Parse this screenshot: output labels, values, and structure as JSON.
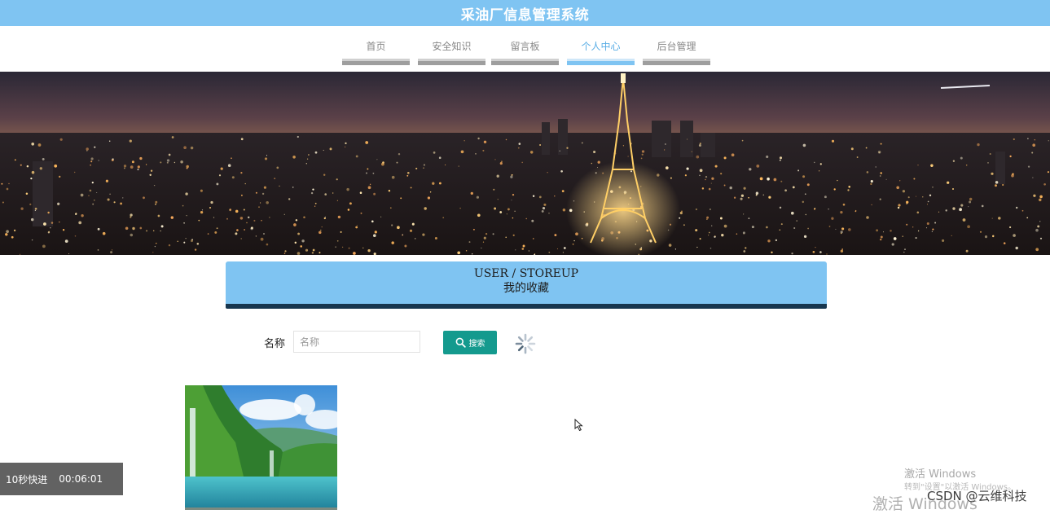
{
  "header": {
    "title": "采油厂信息管理系统"
  },
  "nav": {
    "items": [
      {
        "label": "首页"
      },
      {
        "label": "安全知识"
      },
      {
        "label": "留言板"
      },
      {
        "label": "个人中心"
      },
      {
        "label": "后台管理"
      }
    ],
    "active": "个人中心"
  },
  "section": {
    "title_en": "USER / STOREUP",
    "title_zh": "我的收藏"
  },
  "search": {
    "label": "名称",
    "placeholder": "名称",
    "value": "",
    "button_label": "搜索"
  },
  "overlay": {
    "speed_label": "10秒快进",
    "time": "00:06:01"
  },
  "watermark": {
    "activate_title": "激活 Windows",
    "activate_hint": "转到\"设置\"以激活 Windows。",
    "activate_large": "激活 Windows",
    "csdn": "CSDN @云维科技"
  },
  "colors": {
    "header_bg": "#7fc4f2",
    "accent_blue": "#5aaee6",
    "title_border": "#17364f",
    "search_button": "#149a8e"
  }
}
